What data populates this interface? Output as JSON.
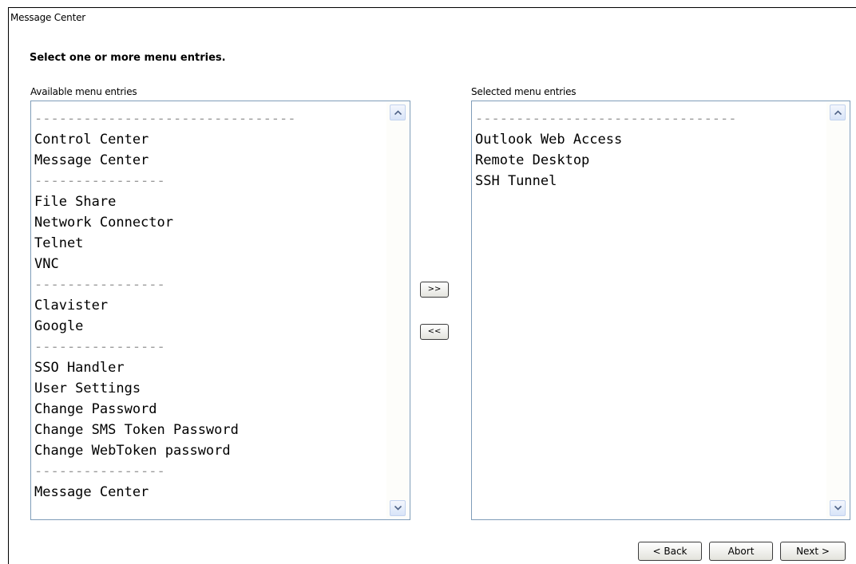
{
  "window": {
    "title": "Message Center"
  },
  "instruction": "Select one or more menu entries.",
  "available": {
    "label": "Available menu entries",
    "items": [
      "--------------------------------",
      "Control Center",
      "Message Center",
      "----------------",
      "File Share",
      "Network Connector",
      "Telnet",
      "VNC",
      "----------------",
      "Clavister",
      "Google",
      "----------------",
      "SSO Handler",
      "User Settings",
      "Change Password",
      "Change SMS Token Password",
      "Change WebToken password",
      "----------------",
      "Message Center"
    ]
  },
  "selected": {
    "label": "Selected menu entries",
    "items": [
      "--------------------------------",
      "Outlook Web Access",
      "Remote Desktop",
      "SSH Tunnel"
    ]
  },
  "buttons": {
    "add": ">>",
    "remove": "<<",
    "back": "< Back",
    "abort": "Abort",
    "next": "Next >"
  },
  "colors": {
    "listbox_border": "#7f9db9",
    "separator_text": "#9a9a9a"
  }
}
